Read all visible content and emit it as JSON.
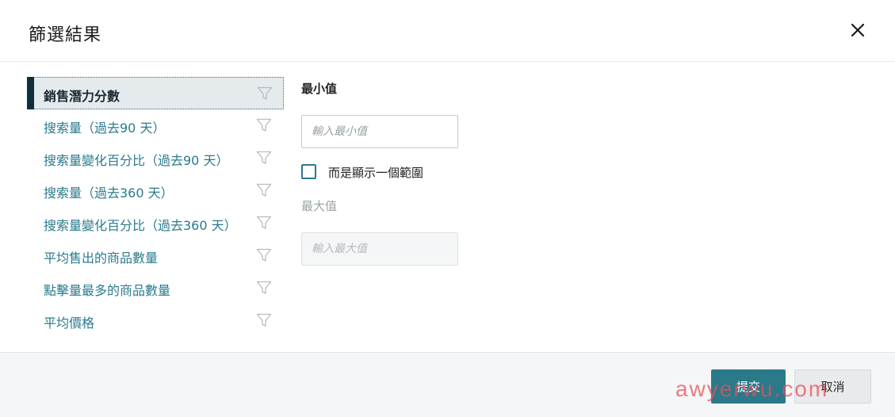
{
  "dialog": {
    "title": "篩選結果",
    "close_icon": "close-icon"
  },
  "filters": {
    "items": [
      {
        "label": "銷售潛力分數",
        "active": true
      },
      {
        "label": "搜索量（過去90 天）",
        "active": false
      },
      {
        "label": "搜索量變化百分比（過去90 天）",
        "active": false
      },
      {
        "label": "搜索量（過去360 天）",
        "active": false
      },
      {
        "label": "搜索量變化百分比（過去360 天）",
        "active": false
      },
      {
        "label": "平均售出的商品數量",
        "active": false
      },
      {
        "label": "點擊量最多的商品數量",
        "active": false
      },
      {
        "label": "平均價格",
        "active": false
      }
    ],
    "icon": "funnel-icon"
  },
  "form": {
    "min_label": "最小值",
    "min_placeholder": "輸入最小值",
    "range_checkbox_label": "而是顯示一個範圍",
    "max_label": "最大值",
    "max_placeholder": "輸入最大值"
  },
  "footer": {
    "submit_label": "提交",
    "cancel_label": "取消",
    "watermark": "awyerwu.com"
  },
  "colors": {
    "accent": "#2b7a8a",
    "active_bar": "#0f2f3f",
    "link_text": "#2a7a8c"
  }
}
